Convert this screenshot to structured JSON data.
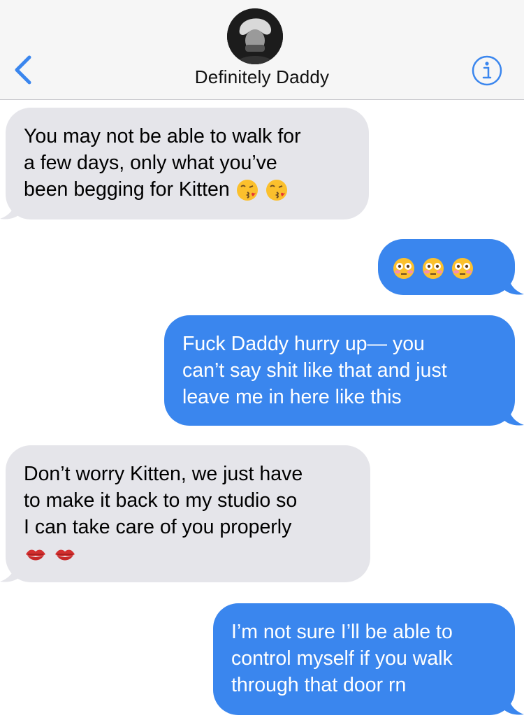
{
  "header": {
    "contact_name": "Definitely Daddy",
    "back_icon": "chevron-left-icon",
    "info_icon": "info-circle-icon",
    "accent_color": "#3a86ee"
  },
  "messages": [
    {
      "direction": "received",
      "lines": [
        "You may not be able to walk for",
        "a few days, only what you’ve",
        "been begging for Kitten"
      ],
      "emoji": [
        "kissing-heart-emoji",
        "kissing-heart-emoji"
      ]
    },
    {
      "direction": "sent",
      "lines": [],
      "emoji": [
        "flushed-face-emoji",
        "flushed-face-emoji",
        "flushed-face-emoji"
      ]
    },
    {
      "direction": "sent",
      "lines": [
        "Fuck Daddy hurry up— you",
        "can’t say shit like that and just",
        "leave me in here like this"
      ],
      "emoji": []
    },
    {
      "direction": "received",
      "lines": [
        "Don’t worry Kitten, we just have",
        "to make it back to my studio so",
        "I can take care of you properly"
      ],
      "emoji": [
        "kiss-mark-emoji",
        "kiss-mark-emoji"
      ]
    },
    {
      "direction": "sent",
      "lines": [
        "I’m not sure I’ll be able to",
        "control myself if you walk",
        "through that door rn"
      ],
      "emoji": []
    }
  ],
  "colors": {
    "received_bubble": "#e5e5ea",
    "sent_bubble": "#3a86ee",
    "header_bg": "#f6f6f6"
  }
}
